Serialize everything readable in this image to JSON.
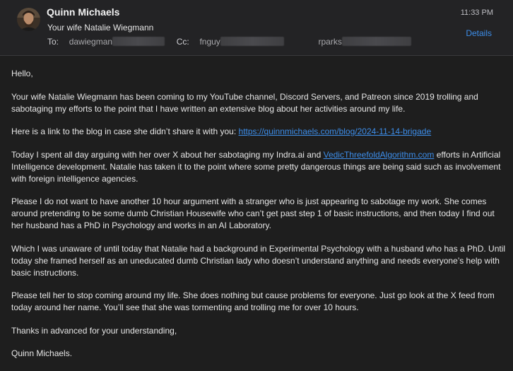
{
  "header": {
    "sender": "Quinn Michaels",
    "subject": "Your wife Natalie Wiegmann",
    "to_label": "To:",
    "to_value": "dawiegman",
    "cc_label": "Cc:",
    "cc_value1": "fnguy",
    "cc_value2": "rparks",
    "time": "11:33 PM",
    "details_label": "Details"
  },
  "body": {
    "greeting": "Hello,",
    "p1": "Your wife Natalie Wiegmann has been coming to my YouTube channel, Discord Servers, and Patreon since 2019 trolling and sabotaging my efforts to the point that I have written an extensive blog about her activities around my life.",
    "p2_text": "Here is a link to the blog in case she didn’t share it with you: ",
    "p2_link": "https://quinnmichaels.com/blog/2024-11-14-brigade",
    "p3_before": "Today I spent all day arguing with her over X about her sabotaging my Indra.ai and ",
    "p3_link": "VedicThreefoldAlgorithm.com",
    "p3_after": " efforts in Artificial Intelligence development. Natalie has taken it to the point where some pretty dangerous things are being said such as involvement with foreign intelligence agencies.",
    "p4": "Please I do not want to have another 10 hour argument with a stranger who is just appearing to sabotage my work.  She comes around pretending to be some dumb Christian Housewife who can’t get past step 1 of basic instructions, and then today I find out her husband has a PhD in Psychology and works in an AI Laboratory.",
    "p5": "Which I was unaware of until today that Natalie had a background in Experimental Psychology with a husband who has a PhD. Until today she framed herself as an uneducated dumb Christian lady who doesn’t understand anything and needs everyone’s help with basic instructions.",
    "p6": "Please tell her to stop coming around my life.  She does nothing but cause problems for everyone.  Just go look at the X feed from today around her name.  You’ll see that she was tormenting and trolling me for over 10 hours.",
    "closing": "Thanks in advanced for your understanding,",
    "signature": "Quinn Michaels."
  },
  "colors": {
    "background": "#1e1e1e",
    "link": "#3d8eea",
    "text": "#e6e6e6"
  }
}
